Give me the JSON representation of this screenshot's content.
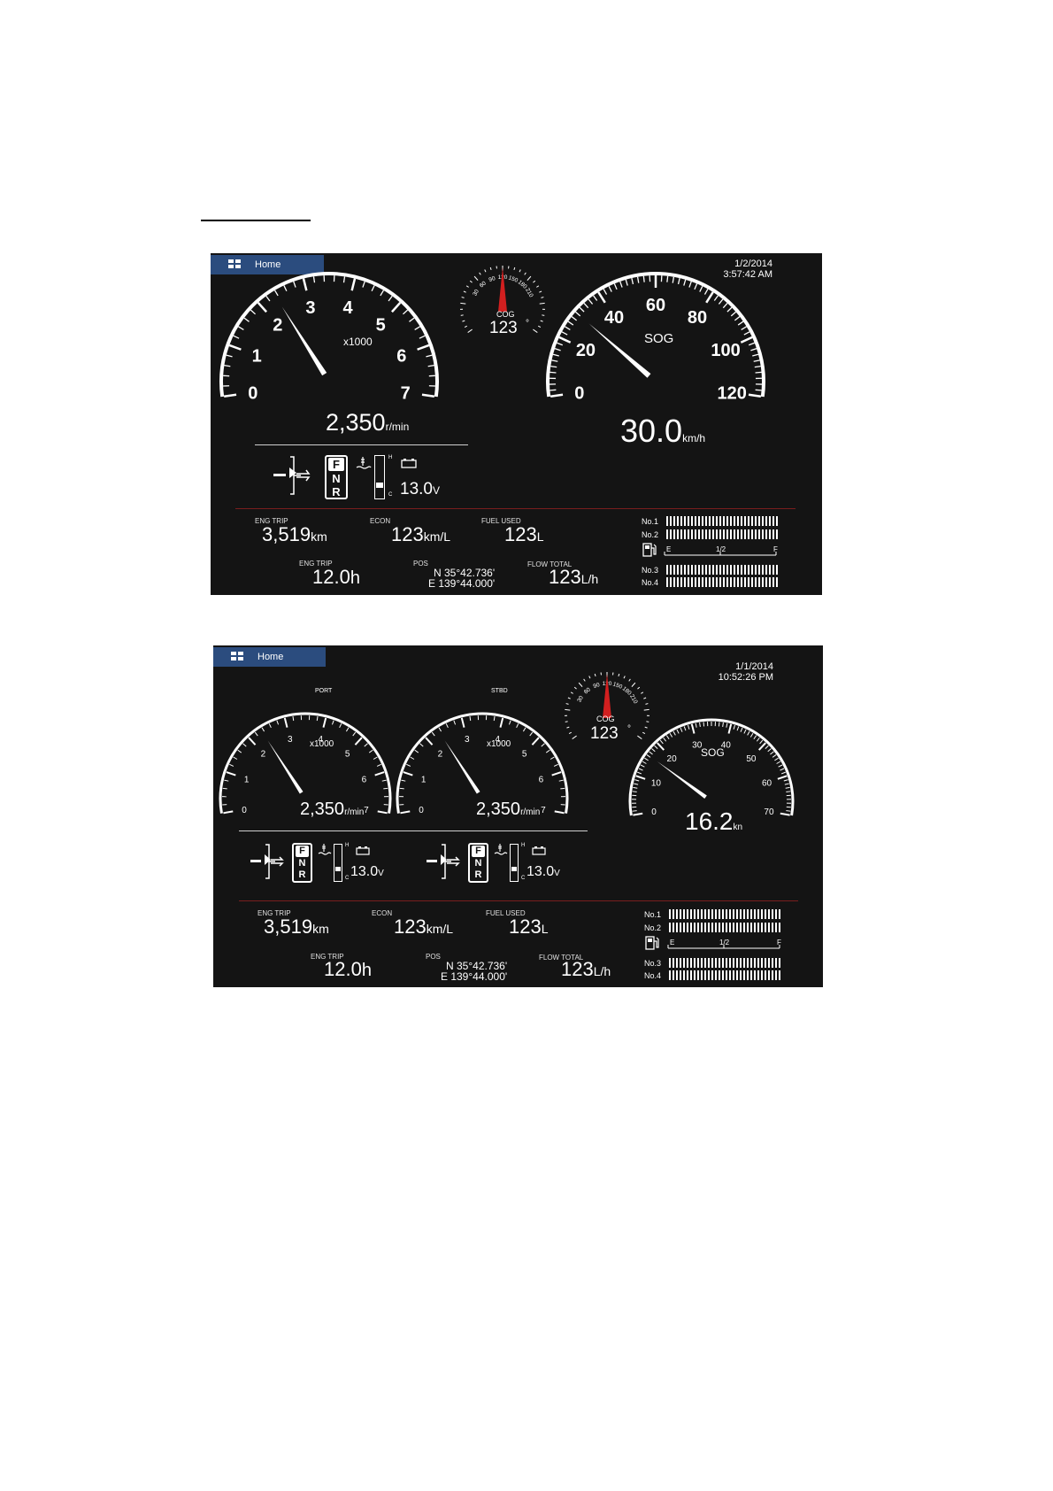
{
  "screen1": {
    "home_label": "Home",
    "date": "1/2/2014",
    "time": "3:57:42 AM",
    "cog": {
      "label": "COG",
      "value": "123",
      "unit": "°",
      "ticks": [
        "30",
        "60",
        "90",
        "120",
        "150",
        "180",
        "210"
      ]
    },
    "rpm": {
      "multiplier": "x1000",
      "value": "2,350",
      "unit": "r/min",
      "ticks": [
        "0",
        "1",
        "2",
        "3",
        "4",
        "5",
        "6",
        "7"
      ],
      "needle_value": 2.35
    },
    "sog": {
      "label": "SOG",
      "value": "30.0",
      "unit": "km/h",
      "ticks": [
        "0",
        "20",
        "40",
        "60",
        "80",
        "100",
        "120"
      ],
      "needle_value": 30.0
    },
    "gear": {
      "f": "F",
      "n": "N",
      "r": "R"
    },
    "temp": {
      "h": "H",
      "c": "C"
    },
    "voltage": {
      "value": "13.0",
      "unit": "V"
    },
    "eng_trip_dist": {
      "label": "ENG TRIP",
      "value": "3,519",
      "unit": "km"
    },
    "econ": {
      "label": "ECON",
      "value": "123",
      "unit": "km/L"
    },
    "fuel_used": {
      "label": "FUEL USED",
      "value": "123",
      "unit": "L"
    },
    "eng_trip_hours": {
      "label": "ENG TRIP",
      "value": "12.0",
      "unit": "h"
    },
    "pos": {
      "label": "POS",
      "lat": "N 35°42.736'",
      "lon": "E 139°44.000'"
    },
    "flow_total": {
      "label": "FLOW TOTAL",
      "value": "123",
      "unit": "L/h"
    },
    "tanks": {
      "no1": "No.1",
      "no2": "No.2",
      "no3": "No.3",
      "no4": "No.4",
      "e": "E",
      "half": "1/2",
      "f": "F"
    }
  },
  "screen2": {
    "home_label": "Home",
    "date": "1/1/2014",
    "time": "10:52:26 PM",
    "cog": {
      "label": "COG",
      "value": "123",
      "unit": "°",
      "ticks": [
        "30",
        "60",
        "90",
        "120",
        "150",
        "180",
        "210"
      ]
    },
    "port": {
      "label": "PORT",
      "multiplier": "x1000",
      "value": "2,350",
      "unit": "r/min",
      "needle_value": 2.35
    },
    "stbd": {
      "label": "STBD",
      "multiplier": "x1000",
      "value": "2,350",
      "unit": "r/min",
      "needle_value": 2.35
    },
    "rpm_ticks": [
      "0",
      "1",
      "2",
      "3",
      "4",
      "5",
      "6",
      "7"
    ],
    "sog": {
      "label": "SOG",
      "value": "16.2",
      "unit": "kn",
      "ticks": [
        "0",
        "10",
        "20",
        "30",
        "40",
        "50",
        "60",
        "70"
      ],
      "needle_value": 16.2
    },
    "gear": {
      "f": "F",
      "n": "N",
      "r": "R"
    },
    "temp": {
      "h": "H",
      "c": "C"
    },
    "voltage_port": {
      "value": "13.0",
      "unit": "V"
    },
    "voltage_stbd": {
      "value": "13.0",
      "unit": "V"
    },
    "eng_trip_dist": {
      "label": "ENG TRIP",
      "value": "3,519",
      "unit": "km"
    },
    "econ": {
      "label": "ECON",
      "value": "123",
      "unit": "km/L"
    },
    "fuel_used": {
      "label": "FUEL USED",
      "value": "123",
      "unit": "L"
    },
    "eng_trip_hours": {
      "label": "ENG TRIP",
      "value": "12.0",
      "unit": "h"
    },
    "pos": {
      "label": "POS",
      "lat": "N 35°42.736'",
      "lon": "E 139°44.000'"
    },
    "flow_total": {
      "label": "FLOW TOTAL",
      "value": "123",
      "unit": "L/h"
    },
    "tanks": {
      "no1": "No.1",
      "no2": "No.2",
      "no3": "No.3",
      "no4": "No.4",
      "e": "E",
      "half": "1/2",
      "f": "F"
    }
  }
}
